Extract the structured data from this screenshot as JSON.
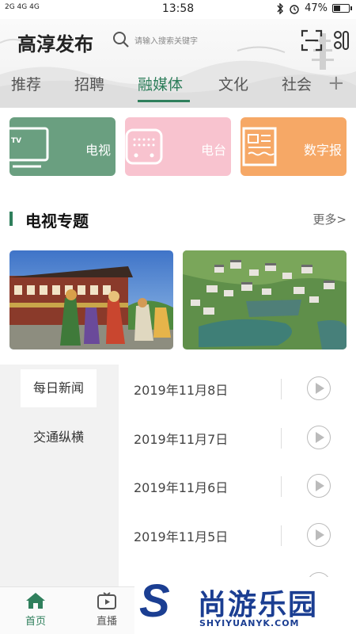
{
  "status_bar": {
    "network": "2G 4G 4G",
    "time": "13:58",
    "battery": "47%",
    "battery_level": 0.47
  },
  "header": {
    "title": "高淳发布",
    "search_placeholder": "请输入搜索关键字",
    "accent_color": "#2f7f5c"
  },
  "tabs": [
    {
      "label": "推荐",
      "active": false
    },
    {
      "label": "招聘",
      "active": false
    },
    {
      "label": "融媒体",
      "active": true
    },
    {
      "label": "文化",
      "active": false
    },
    {
      "label": "社会",
      "active": false
    }
  ],
  "add_tab_label": "+",
  "media_cards": [
    {
      "label": "电视",
      "icon": "tv-icon",
      "color": "#6a9f80"
    },
    {
      "label": "电台",
      "icon": "radio-icon",
      "color": "#f8c3cf"
    },
    {
      "label": "数字报",
      "icon": "newspaper-icon",
      "color": "#f6a866"
    }
  ],
  "section": {
    "title": "电视专题",
    "more": "更多>"
  },
  "side_menu": [
    {
      "label": "每日新闻",
      "active": true
    },
    {
      "label": "交通纵横",
      "active": false
    }
  ],
  "news_dates": [
    "2019年11月8日",
    "2019年11月7日",
    "2019年11月6日",
    "2019年11月5日"
  ],
  "bottom_nav": [
    {
      "label": "首页",
      "icon": "home-icon",
      "active": true
    },
    {
      "label": "直播",
      "icon": "tv-live-icon",
      "active": false
    }
  ],
  "watermark": {
    "logo_letter": "S",
    "cn": "尚游乐园",
    "en": "SHYIYUANYK.COM"
  }
}
